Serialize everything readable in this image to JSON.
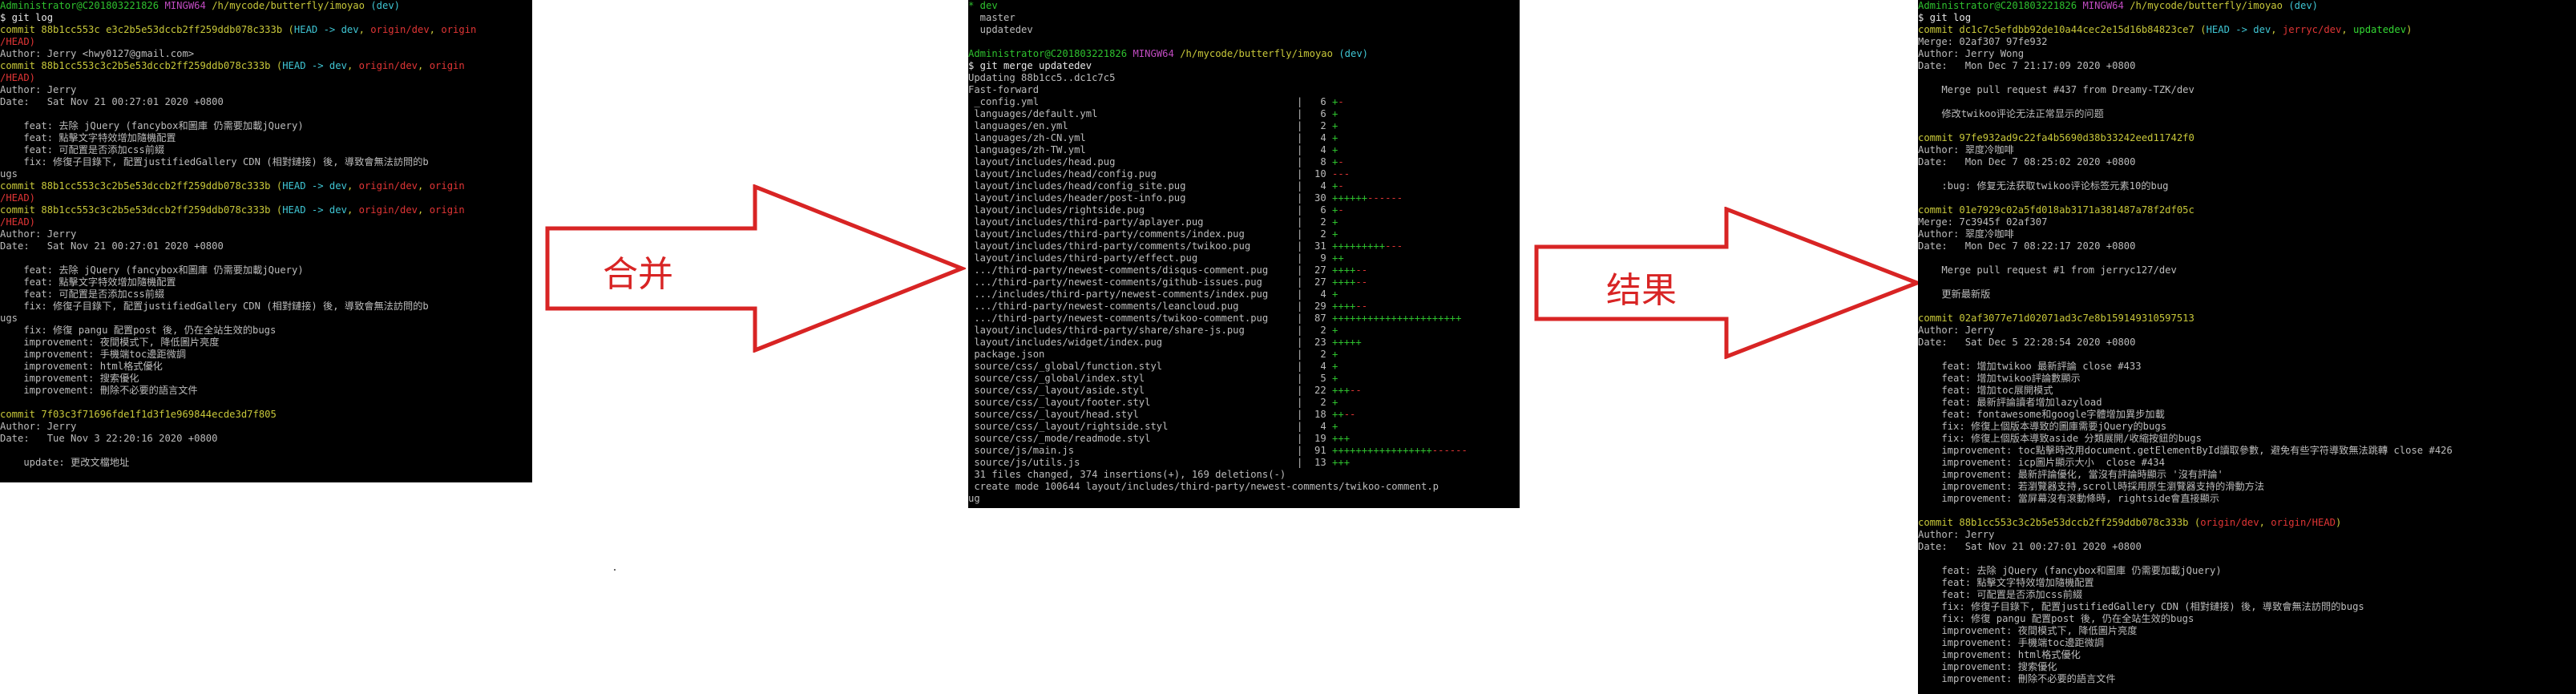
{
  "colors": {
    "terminal_bg": "#000000",
    "prompt_user": "#2ec02e",
    "prompt_host": "#c04bc0",
    "path": "#c8c83a",
    "branch": "#3fc6d4",
    "commit": "#c8c83a",
    "arrow": "#d82424"
  },
  "arrows": {
    "merge_label": "合并",
    "result_label": "结果"
  },
  "panel1": {
    "prompt": {
      "user": "Administrator@C201803221826",
      "host": "MINGW64",
      "path": "/h/mycode/butterfly/imoyao",
      "branch": "(dev)"
    },
    "command": "$ git log",
    "lines": [
      {
        "t": "commit",
        "hash": "commit 88b1cc553c e3c2b5e53dccb2ff259ddb078c333b",
        "refs": [
          {
            "c": "head",
            "t": "HEAD -> dev"
          },
          {
            "c": "remote",
            "t": "origin/dev"
          },
          {
            "c": "remote",
            "t": "origin"
          }
        ],
        "wrap": "/HEAD)"
      },
      {
        "t": "plain",
        "text": "Author: Jerry <hwy0127@gmail.com>"
      },
      {
        "t": "commit",
        "hash": "commit 88b1cc553c3c2b5e53dccb2ff259ddb078c333b",
        "refs": [
          {
            "c": "head",
            "t": "HEAD -> dev"
          },
          {
            "c": "remote",
            "t": "origin/dev"
          },
          {
            "c": "remote",
            "t": "origin"
          }
        ],
        "wrap": "/HEAD)"
      },
      {
        "t": "plain",
        "text": "Author: Jerry"
      },
      {
        "t": "plain",
        "text": "Date:   Sat Nov 21 00:27:01 2020 +0800"
      },
      {
        "t": "gap"
      },
      {
        "t": "plain",
        "text": "    feat: 去除 jQuery (fancybox和圖庫 仍需要加載jQuery)"
      },
      {
        "t": "plain",
        "text": "    feat: 點擊文字特效增加隨機配置"
      },
      {
        "t": "plain",
        "text": "    feat: 可配置是否添加css前綴"
      },
      {
        "t": "plain",
        "text": "    fix: 修復子目錄下, 配置justifiedGallery CDN (相對鏈接) 後, 導致會無法訪問的b"
      },
      {
        "t": "plain",
        "text": "ugs"
      },
      {
        "t": "commit",
        "hash": "commit 88b1cc553c3c2b5e53dccb2ff259ddb078c333b",
        "refs": [
          {
            "c": "head",
            "t": "HEAD -> dev"
          },
          {
            "c": "remote",
            "t": "origin/dev"
          },
          {
            "c": "remote",
            "t": "origin"
          }
        ],
        "wrap": "/HEAD)"
      },
      {
        "t": "commit",
        "hash": "commit 88b1cc553c3c2b5e53dccb2ff259ddb078c333b",
        "refs": [
          {
            "c": "head",
            "t": "HEAD -> dev"
          },
          {
            "c": "remote",
            "t": "origin/dev"
          },
          {
            "c": "remote",
            "t": "origin"
          }
        ],
        "wrap": "/HEAD)"
      },
      {
        "t": "plain",
        "text": "Author: Jerry"
      },
      {
        "t": "plain",
        "text": "Date:   Sat Nov 21 00:27:01 2020 +0800"
      },
      {
        "t": "gap"
      },
      {
        "t": "plain",
        "text": "    feat: 去除 jQuery (fancybox和圖庫 仍需要加載jQuery)"
      },
      {
        "t": "plain",
        "text": "    feat: 點擊文字特效增加隨機配置"
      },
      {
        "t": "plain",
        "text": "    feat: 可配置是否添加css前綴"
      },
      {
        "t": "plain",
        "text": "    fix: 修復子目錄下, 配置justifiedGallery CDN (相對鏈接) 後, 導致會無法訪問的b"
      },
      {
        "t": "plain",
        "text": "ugs"
      },
      {
        "t": "plain",
        "text": "    fix: 修復 pangu 配置post 後, 仍在全站生效的bugs"
      },
      {
        "t": "plain",
        "text": "    improvement: 夜間模式下, 降低圖片亮度"
      },
      {
        "t": "plain",
        "text": "    improvement: 手機端toc邊距微調"
      },
      {
        "t": "plain",
        "text": "    improvement: html格式優化"
      },
      {
        "t": "plain",
        "text": "    improvement: 搜索優化"
      },
      {
        "t": "plain",
        "text": "    improvement: 刪除不必要的語言文件"
      },
      {
        "t": "gap"
      },
      {
        "t": "commit",
        "hash": "commit 7f03c3f71696fde1f1d3f1e969844ecde3d7f805",
        "refs": []
      },
      {
        "t": "plain",
        "text": "Author: Jerry"
      },
      {
        "t": "plain",
        "text": "Date:   Tue Nov 3 22:20:16 2020 +0800"
      },
      {
        "t": "gap"
      },
      {
        "t": "plain",
        "text": "    update: 更改文檔地址"
      }
    ]
  },
  "panel2": {
    "top_lines": [
      "* dev",
      "  master",
      "  updatedev"
    ],
    "prompt": {
      "user": "Administrator@C201803221826",
      "host": "MINGW64",
      "path": "/h/mycode/butterfly/imoyao",
      "branch": "(dev)"
    },
    "command": "$ git merge updatedev",
    "pre": [
      "Updating 88b1cc5..dc1c7c5",
      "Fast-forward"
    ],
    "files": [
      {
        "name": " _config.yml",
        "count": "6",
        "plus": 1,
        "minus": 1
      },
      {
        "name": " languages/default.yml",
        "count": "6",
        "plus": 1,
        "minus": 0
      },
      {
        "name": " languages/en.yml",
        "count": "2",
        "plus": 1,
        "minus": 0
      },
      {
        "name": " languages/zh-CN.yml",
        "count": "4",
        "plus": 1,
        "minus": 0
      },
      {
        "name": " languages/zh-TW.yml",
        "count": "4",
        "plus": 1,
        "minus": 0
      },
      {
        "name": " layout/includes/head.pug",
        "count": "8",
        "plus": 1,
        "minus": 1
      },
      {
        "name": " layout/includes/head/config.pug",
        "count": "10",
        "plus": 0,
        "minus": 3
      },
      {
        "name": " layout/includes/head/config_site.pug",
        "count": "4",
        "plus": 1,
        "minus": 1
      },
      {
        "name": " layout/includes/header/post-info.pug",
        "count": "30",
        "plus": 6,
        "minus": 6
      },
      {
        "name": " layout/includes/rightside.pug",
        "count": "6",
        "plus": 1,
        "minus": 1
      },
      {
        "name": " layout/includes/third-party/aplayer.pug",
        "count": "2",
        "plus": 1,
        "minus": 0
      },
      {
        "name": " layout/includes/third-party/comments/index.pug",
        "count": "2",
        "plus": 1,
        "minus": 0
      },
      {
        "name": " layout/includes/third-party/comments/twikoo.pug",
        "count": "31",
        "plus": 9,
        "minus": 3
      },
      {
        "name": " layout/includes/third-party/effect.pug",
        "count": "9",
        "plus": 2,
        "minus": 0
      },
      {
        "name": " .../third-party/newest-comments/disqus-comment.pug",
        "count": "27",
        "plus": 4,
        "minus": 2
      },
      {
        "name": " .../third-party/newest-comments/github-issues.pug",
        "count": "27",
        "plus": 4,
        "minus": 2
      },
      {
        "name": " .../includes/third-party/newest-comments/index.pug",
        "count": "4",
        "plus": 1,
        "minus": 0
      },
      {
        "name": " .../third-party/newest-comments/leancloud.pug",
        "count": "29",
        "plus": 4,
        "minus": 2
      },
      {
        "name": " .../third-party/newest-comments/twikoo-comment.pug",
        "count": "87",
        "plus": 22,
        "minus": 0
      },
      {
        "name": " layout/includes/third-party/share/share-js.pug",
        "count": "2",
        "plus": 1,
        "minus": 0
      },
      {
        "name": " layout/includes/widget/index.pug",
        "count": "23",
        "plus": 5,
        "minus": 0
      },
      {
        "name": " package.json",
        "count": "2",
        "plus": 1,
        "minus": 0
      },
      {
        "name": " source/css/_global/function.styl",
        "count": "4",
        "plus": 1,
        "minus": 0
      },
      {
        "name": " source/css/_global/index.styl",
        "count": "5",
        "plus": 1,
        "minus": 0
      },
      {
        "name": " source/css/_layout/aside.styl",
        "count": "22",
        "plus": 3,
        "minus": 2
      },
      {
        "name": " source/css/_layout/footer.styl",
        "count": "2",
        "plus": 1,
        "minus": 0
      },
      {
        "name": " source/css/_layout/head.styl",
        "count": "18",
        "plus": 2,
        "minus": 2
      },
      {
        "name": " source/css/_layout/rightside.styl",
        "count": "4",
        "plus": 1,
        "minus": 0
      },
      {
        "name": " source/css/_mode/readmode.styl",
        "count": "19",
        "plus": 3,
        "minus": 0
      },
      {
        "name": " source/js/main.js",
        "count": "91",
        "plus": 17,
        "minus": 6
      },
      {
        "name": " source/js/utils.js",
        "count": "13",
        "plus": 3,
        "minus": 0
      }
    ],
    "summary": [
      " 31 files changed, 374 insertions(+), 169 deletions(-)",
      " create mode 100644 layout/includes/third-party/newest-comments/twikoo-comment.p",
      "ug"
    ]
  },
  "panel3": {
    "prompt": {
      "user": "Administrator@C201803221826",
      "host": "MINGW64",
      "path": "/h/mycode/butterfly/imoyao",
      "branch": "(dev)"
    },
    "command": "$ git log",
    "lines": [
      {
        "t": "commit",
        "hash": "commit dc1c7c5efdbb92de10a44cec2e15d16b84823ce7",
        "refs": [
          {
            "c": "head",
            "t": "HEAD -> dev"
          },
          {
            "c": "remote",
            "t": "jerryc/dev"
          },
          {
            "c": "dev",
            "t": "updatedev"
          }
        ]
      },
      {
        "t": "plain",
        "text": "Merge: 02af307 97fe932"
      },
      {
        "t": "plain",
        "text": "Author: Jerry Wong"
      },
      {
        "t": "plain",
        "text": "Date:   Mon Dec 7 21:17:09 2020 +0800"
      },
      {
        "t": "gap"
      },
      {
        "t": "plain",
        "text": "    Merge pull request #437 from Dreamy-TZK/dev"
      },
      {
        "t": "gap"
      },
      {
        "t": "plain",
        "text": "    修改twikoo评论无法正常显示的问题"
      },
      {
        "t": "gap"
      },
      {
        "t": "commit",
        "hash": "commit 97fe932ad9c22fa4b5690d38b33242eed11742f0",
        "refs": []
      },
      {
        "t": "plain",
        "text": "Author: 翠度冷咖啡"
      },
      {
        "t": "plain",
        "text": "Date:   Mon Dec 7 08:25:02 2020 +0800"
      },
      {
        "t": "gap"
      },
      {
        "t": "plain",
        "text": "    :bug: 修复无法获取twikoo评论标签元素10的bug"
      },
      {
        "t": "gap"
      },
      {
        "t": "commit",
        "hash": "commit 01e7929c02a5fd018ab3171a381487a78f2df05c",
        "refs": []
      },
      {
        "t": "plain",
        "text": "Merge: 7c3945f 02af307"
      },
      {
        "t": "plain",
        "text": "Author: 翠度冷咖啡"
      },
      {
        "t": "plain",
        "text": "Date:   Mon Dec 7 08:22:17 2020 +0800"
      },
      {
        "t": "gap"
      },
      {
        "t": "plain",
        "text": "    Merge pull request #1 from jerryc127/dev"
      },
      {
        "t": "gap"
      },
      {
        "t": "plain",
        "text": "    更新最新版"
      },
      {
        "t": "gap"
      },
      {
        "t": "commit",
        "hash": "commit 02af3077e71d02071ad3c7e8b159149310597513",
        "refs": []
      },
      {
        "t": "plain",
        "text": "Author: Jerry"
      },
      {
        "t": "plain",
        "text": "Date:   Sat Dec 5 22:28:54 2020 +0800"
      },
      {
        "t": "gap"
      },
      {
        "t": "plain",
        "text": "    feat: 增加twikoo 最新評論 close #433"
      },
      {
        "t": "plain",
        "text": "    feat: 增加twikoo評論數顯示"
      },
      {
        "t": "plain",
        "text": "    feat: 增加toc展開模式"
      },
      {
        "t": "plain",
        "text": "    feat: 最新評論讀者增加lazyload"
      },
      {
        "t": "plain",
        "text": "    feat: fontawesome和google字體增加異步加載"
      },
      {
        "t": "plain",
        "text": "    fix: 修復上個版本導致的圖庫需要jQuery的bugs"
      },
      {
        "t": "plain",
        "text": "    fix: 修復上個版本導致aside 分類展開/收縮按鈕的bugs"
      },
      {
        "t": "plain",
        "text": "    improvement: toc點擊時改用document.getElementById讀取參數, 避免有些字符導致無法跳轉 close #426"
      },
      {
        "t": "plain",
        "text": "    improvement: icp圖片顯示大小  close #434"
      },
      {
        "t": "plain",
        "text": "    improvement: 最新評論優化, 當沒有評論時顯示 '沒有評論'"
      },
      {
        "t": "plain",
        "text": "    improvement: 若瀏覽器支持,scroll時採用原生瀏覽器支持的滑動方法"
      },
      {
        "t": "plain",
        "text": "    improvement: 當屏幕沒有滾動條時, rightside會直接顯示"
      },
      {
        "t": "gap"
      },
      {
        "t": "commit",
        "hash": "commit 88b1cc553c3c2b5e53dccb2ff259ddb078c333b",
        "refs": [
          {
            "c": "remote",
            "t": "origin/dev"
          },
          {
            "c": "remote",
            "t": "origin/HEAD"
          }
        ]
      },
      {
        "t": "plain",
        "text": "Author: Jerry"
      },
      {
        "t": "plain",
        "text": "Date:   Sat Nov 21 00:27:01 2020 +0800"
      },
      {
        "t": "gap"
      },
      {
        "t": "plain",
        "text": "    feat: 去除 jQuery (fancybox和圖庫 仍需要加載jQuery)"
      },
      {
        "t": "plain",
        "text": "    feat: 點擊文字特效增加隨機配置"
      },
      {
        "t": "plain",
        "text": "    feat: 可配置是否添加css前綴"
      },
      {
        "t": "plain",
        "text": "    fix: 修復子目錄下, 配置justifiedGallery CDN (相對鏈接) 後, 導致會無法訪問的bugs"
      },
      {
        "t": "plain",
        "text": "    fix: 修復 pangu 配置post 後, 仍在全站生效的bugs"
      },
      {
        "t": "plain",
        "text": "    improvement: 夜間模式下, 降低圖片亮度"
      },
      {
        "t": "plain",
        "text": "    improvement: 手機端toc邊距微調"
      },
      {
        "t": "plain",
        "text": "    improvement: html格式優化"
      },
      {
        "t": "plain",
        "text": "    improvement: 搜索優化"
      },
      {
        "t": "plain",
        "text": "    improvement: 刪除不必要的語言文件"
      }
    ]
  }
}
